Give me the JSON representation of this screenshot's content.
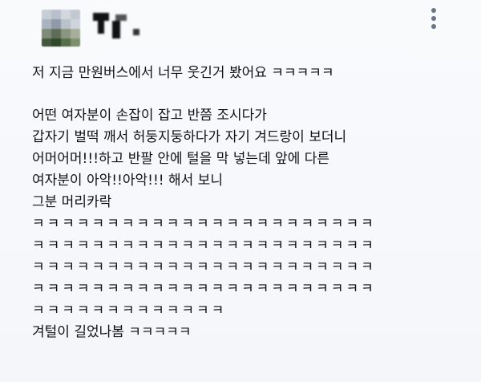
{
  "header": {
    "more_icon": "more-vertical-icon"
  },
  "colors": {
    "background": "#f7f8fb",
    "text": "#111111",
    "more_icon": "#6a7585"
  },
  "post": {
    "intro": "저 지금 만원버스에서 너무 웃긴거 봤어요 ㅋㅋㅋㅋㅋ",
    "story_lines": [
      "어떤 여자분이 손잡이 잡고 반쯤 조시다가",
      "갑자기 벌떡 깨서 허둥지둥하다가 자기 겨드랑이 보더니",
      "어머어머!!!하고 반팔 안에 털을 막 넣는데 앞에 다른",
      "여자분이 아악!!아악!!! 해서 보니",
      "그분 머리카락"
    ],
    "laugh_lines": [
      "ㅋㅋㅋㅋㅋㅋㅋㅋㅋㅋㅋㅋㅋㅋㅋㅋㅋㅋㅋㅋㅋㅋㅋ",
      "ㅋㅋㅋㅋㅋㅋㅋㅋㅋㅋㅋㅋㅋㅋㅋㅋㅋㅋㅋㅋㅋㅋㅋ",
      "ㅋㅋㅋㅋㅋㅋㅋㅋㅋㅋㅋㅋㅋㅋㅋㅋㅋㅋㅋㅋㅋㅋㅋ",
      "ㅋㅋㅋㅋㅋㅋㅋㅋㅋㅋㅋㅋㅋㅋㅋㅋㅋㅋㅋㅋㅋㅋㅋ",
      "ㅋㅋㅋㅋㅋㅋㅋㅋㅋㅋㅋㅋㅋ"
    ],
    "closing": "겨털이 길었나봄 ㅋㅋㅋㅋㅋ"
  }
}
